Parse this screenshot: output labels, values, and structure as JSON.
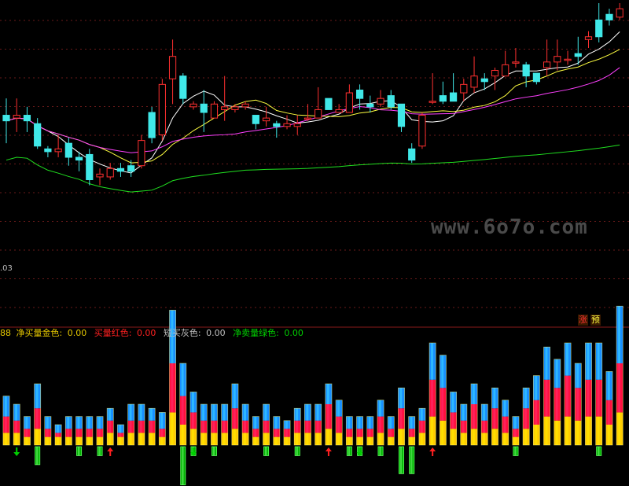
{
  "legend": {
    "prefix": "88",
    "items": [
      {
        "label": "净买量金色:",
        "value": "0.00",
        "color": "#e6c800"
      },
      {
        "label": "买量红色:",
        "value": "0.00",
        "color": "#ff2020"
      },
      {
        "label": "短买灰色:",
        "value": "0.00",
        "color": "#c0c0c0"
      },
      {
        "label": "净卖量绿色:",
        "value": "0.00",
        "color": "#00d000"
      }
    ]
  },
  "badges": {
    "zhang": "涨",
    "yu": "预"
  },
  "price_label": ".03",
  "watermark": "www.6o7o.com",
  "colors": {
    "bull": "#ff3030",
    "bear": "#40e8e8",
    "ma5": "#ffffff",
    "ma10": "#ffff40",
    "ma20": "#ff40ff",
    "ma60": "#20e020",
    "grid": "#6a1a1a"
  },
  "chart_data": [
    {
      "type": "candlestick",
      "ylim": [
        0,
        100
      ],
      "candles": [
        [
          70,
          68,
          76,
          60
        ],
        [
          69,
          70,
          76,
          64
        ],
        [
          70,
          68,
          73,
          64
        ],
        [
          67,
          59,
          69,
          58
        ],
        [
          58,
          57,
          59,
          55
        ],
        [
          57,
          58,
          63,
          55
        ],
        [
          60,
          55,
          62,
          52
        ],
        [
          55,
          54,
          57,
          50
        ],
        [
          56,
          47,
          58,
          45
        ],
        [
          48,
          49,
          51,
          45
        ],
        [
          48,
          51,
          53,
          47
        ],
        [
          51,
          50,
          53,
          48
        ],
        [
          52,
          50,
          54,
          48
        ],
        [
          52,
          61,
          63,
          51
        ],
        [
          71,
          62,
          73,
          60
        ],
        [
          63,
          81,
          83,
          61
        ],
        [
          83,
          91,
          97,
          74
        ],
        [
          84,
          76,
          85,
          74
        ],
        [
          73,
          74,
          75,
          72
        ],
        [
          74,
          71,
          79,
          64
        ],
        [
          69,
          74,
          75,
          69
        ],
        [
          72,
          73,
          84,
          68
        ],
        [
          72,
          73,
          74,
          71
        ],
        [
          73,
          74,
          75,
          72
        ],
        [
          70,
          67,
          70,
          65
        ],
        [
          68,
          69,
          73,
          66
        ],
        [
          67,
          66,
          68,
          62
        ],
        [
          66,
          67,
          70,
          65
        ],
        [
          66,
          67,
          70,
          63
        ],
        [
          69,
          69,
          74,
          68
        ],
        [
          69,
          72,
          80,
          69
        ],
        [
          76,
          72,
          76,
          72
        ],
        [
          71,
          72,
          74,
          71
        ],
        [
          71,
          78,
          81,
          71
        ],
        [
          79,
          76,
          81,
          72
        ],
        [
          74,
          73,
          77,
          71
        ],
        [
          74,
          76,
          79,
          73
        ],
        [
          77,
          73,
          79,
          72
        ],
        [
          74,
          66,
          74,
          64
        ],
        [
          58,
          54,
          60,
          53
        ],
        [
          59,
          70,
          71,
          58
        ],
        [
          75,
          75,
          85,
          74
        ],
        [
          77,
          75,
          82,
          74
        ],
        [
          78,
          75,
          85,
          76
        ],
        [
          78,
          81,
          83,
          75
        ],
        [
          80,
          84,
          91,
          78
        ],
        [
          83,
          82,
          85,
          79
        ],
        [
          84,
          86,
          87,
          79
        ],
        [
          84,
          88,
          93,
          84
        ],
        [
          89,
          89,
          94,
          87
        ],
        [
          88,
          84,
          89,
          80
        ],
        [
          85,
          82,
          84,
          81
        ],
        [
          87,
          89,
          97,
          84
        ],
        [
          89,
          91,
          97,
          86
        ],
        [
          90,
          90,
          93,
          88
        ],
        [
          92,
          91,
          98,
          88
        ],
        [
          97,
          98,
          100,
          94
        ],
        [
          104,
          98,
          110,
          96
        ],
        [
          106,
          104,
          108,
          102
        ],
        [
          105,
          108,
          110,
          104
        ]
      ]
    },
    {
      "type": "stacked-bar",
      "series": [
        {
          "values": [
            3,
            3,
            2,
            4,
            2,
            2,
            2,
            2,
            2,
            2,
            3,
            2,
            3,
            3,
            3,
            2,
            8,
            5,
            4,
            3,
            3,
            3,
            4,
            3,
            2,
            3,
            2,
            2,
            3,
            3,
            3,
            4,
            3,
            2,
            2,
            2,
            3,
            2,
            4,
            2,
            3,
            7,
            6,
            4,
            3,
            4,
            3,
            4,
            3,
            2,
            4,
            5,
            7,
            6,
            7,
            6,
            7,
            7,
            5,
            8
          ]
        },
        {
          "values": [
            4,
            3,
            2,
            5,
            2,
            1,
            2,
            2,
            2,
            2,
            3,
            1,
            3,
            3,
            3,
            2,
            12,
            7,
            4,
            3,
            3,
            3,
            5,
            3,
            2,
            3,
            2,
            2,
            3,
            3,
            3,
            6,
            4,
            2,
            2,
            2,
            4,
            2,
            5,
            2,
            3,
            9,
            8,
            4,
            3,
            6,
            3,
            5,
            4,
            2,
            5,
            6,
            9,
            8,
            10,
            8,
            9,
            9,
            6,
            12
          ]
        },
        {
          "values": [
            5,
            4,
            3,
            6,
            3,
            2,
            3,
            3,
            3,
            3,
            3,
            2,
            4,
            4,
            3,
            4,
            13,
            8,
            5,
            4,
            4,
            4,
            6,
            4,
            3,
            4,
            3,
            2,
            3,
            4,
            4,
            5,
            4,
            3,
            3,
            3,
            4,
            3,
            5,
            3,
            3,
            9,
            8,
            5,
            4,
            5,
            4,
            5,
            4,
            3,
            5,
            6,
            8,
            7,
            8,
            6,
            9,
            9,
            7,
            14
          ]
        },
        {
          "values": [
            0,
            0,
            0,
            0,
            0,
            0,
            0,
            0,
            0,
            0,
            0,
            0,
            0,
            0,
            0,
            0,
            0,
            0,
            0,
            0,
            0,
            0,
            0,
            0,
            0,
            0,
            0,
            0,
            0,
            0,
            0,
            0,
            0,
            0,
            0,
            0,
            0,
            0,
            0,
            0,
            0,
            0,
            0,
            0,
            0,
            0,
            0,
            0,
            0,
            0,
            0,
            0,
            0,
            0,
            0,
            0,
            0,
            0,
            0,
            0
          ]
        },
        {
          "values": [
            0,
            0,
            0,
            -8,
            0,
            0,
            0,
            -4,
            0,
            -4,
            0,
            0,
            0,
            0,
            0,
            0,
            0,
            -17,
            -4,
            0,
            -4,
            0,
            0,
            0,
            0,
            -4,
            0,
            0,
            -4,
            0,
            0,
            0,
            0,
            -4,
            -4,
            0,
            -4,
            0,
            -12,
            -12,
            0,
            0,
            0,
            0,
            0,
            0,
            0,
            0,
            0,
            -4,
            0,
            0,
            0,
            0,
            0,
            0,
            0,
            -4,
            0,
            0
          ]
        }
      ],
      "arrows": [
        [
          1,
          "down"
        ],
        [
          10,
          "up"
        ],
        [
          18,
          "down"
        ],
        [
          31,
          "up"
        ],
        [
          34,
          "down"
        ],
        [
          41,
          "up"
        ]
      ]
    }
  ]
}
